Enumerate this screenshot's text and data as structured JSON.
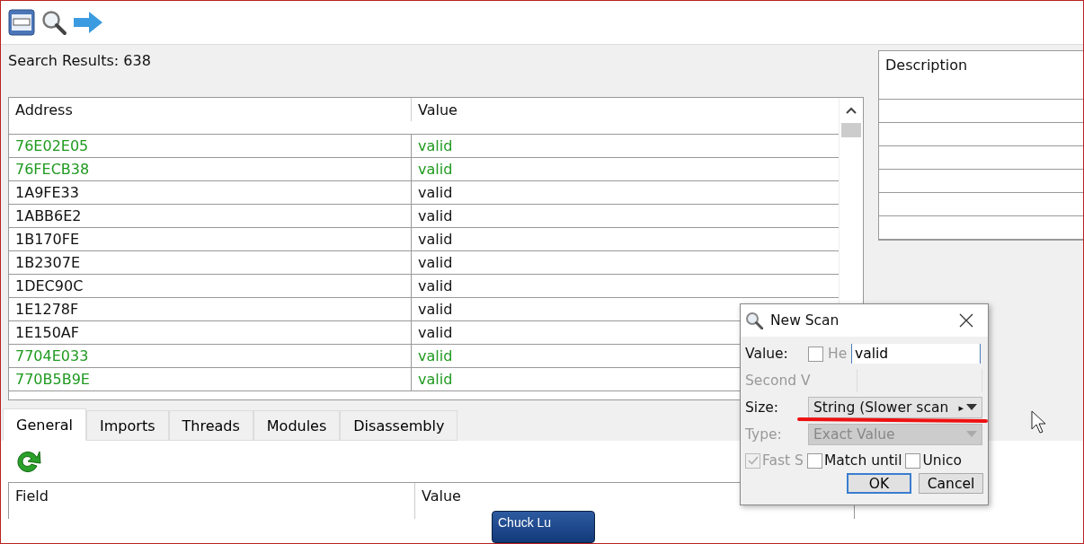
{
  "results_label": "Search Results: 638",
  "results_table": {
    "columns": [
      "Address",
      "Value"
    ],
    "rows": [
      {
        "address": "76E02E05",
        "value": "valid",
        "static": true
      },
      {
        "address": "76FECB38",
        "value": "valid",
        "static": true
      },
      {
        "address": "1A9FE33",
        "value": "valid",
        "static": false
      },
      {
        "address": "1ABB6E2",
        "value": "valid",
        "static": false
      },
      {
        "address": "1B170FE",
        "value": "valid",
        "static": false
      },
      {
        "address": "1B2307E",
        "value": "valid",
        "static": false
      },
      {
        "address": "1DEC90C",
        "value": "valid",
        "static": false
      },
      {
        "address": "1E1278F",
        "value": "valid",
        "static": false
      },
      {
        "address": "1E150AF",
        "value": "valid",
        "static": false
      },
      {
        "address": "7704E033",
        "value": "valid",
        "static": true
      },
      {
        "address": "770B5B9E",
        "value": "valid",
        "static": true
      }
    ]
  },
  "description_table": {
    "columns": [
      "Description"
    ]
  },
  "tabs": [
    {
      "label": "General",
      "selected": true
    },
    {
      "label": "Imports",
      "selected": false
    },
    {
      "label": "Threads",
      "selected": false
    },
    {
      "label": "Modules",
      "selected": false
    },
    {
      "label": "Disassembly",
      "selected": false
    }
  ],
  "general_table": {
    "columns": [
      "Field",
      "Value"
    ]
  },
  "dialog": {
    "title": "New Scan",
    "value_label": "Value:",
    "hex": {
      "label": "He",
      "checked": false
    },
    "value": "valid",
    "second_label": {
      "text": "Second V",
      "disabled": true
    },
    "size_label": "Size:",
    "size_value": "String (Slower scan",
    "size_arrow": "▸",
    "type_label": {
      "text": "Type:",
      "disabled": true
    },
    "type_value": {
      "text": "Exact Value",
      "disabled": true
    },
    "options": [
      {
        "label": "Fast S",
        "checked": true,
        "disabled": true
      },
      {
        "label": "Match until",
        "checked": false,
        "disabled": false
      },
      {
        "label": "Unico",
        "checked": false,
        "disabled": false
      }
    ],
    "buttons": [
      "OK",
      "Cancel"
    ]
  },
  "taskbar_label": "Chuck Lu"
}
